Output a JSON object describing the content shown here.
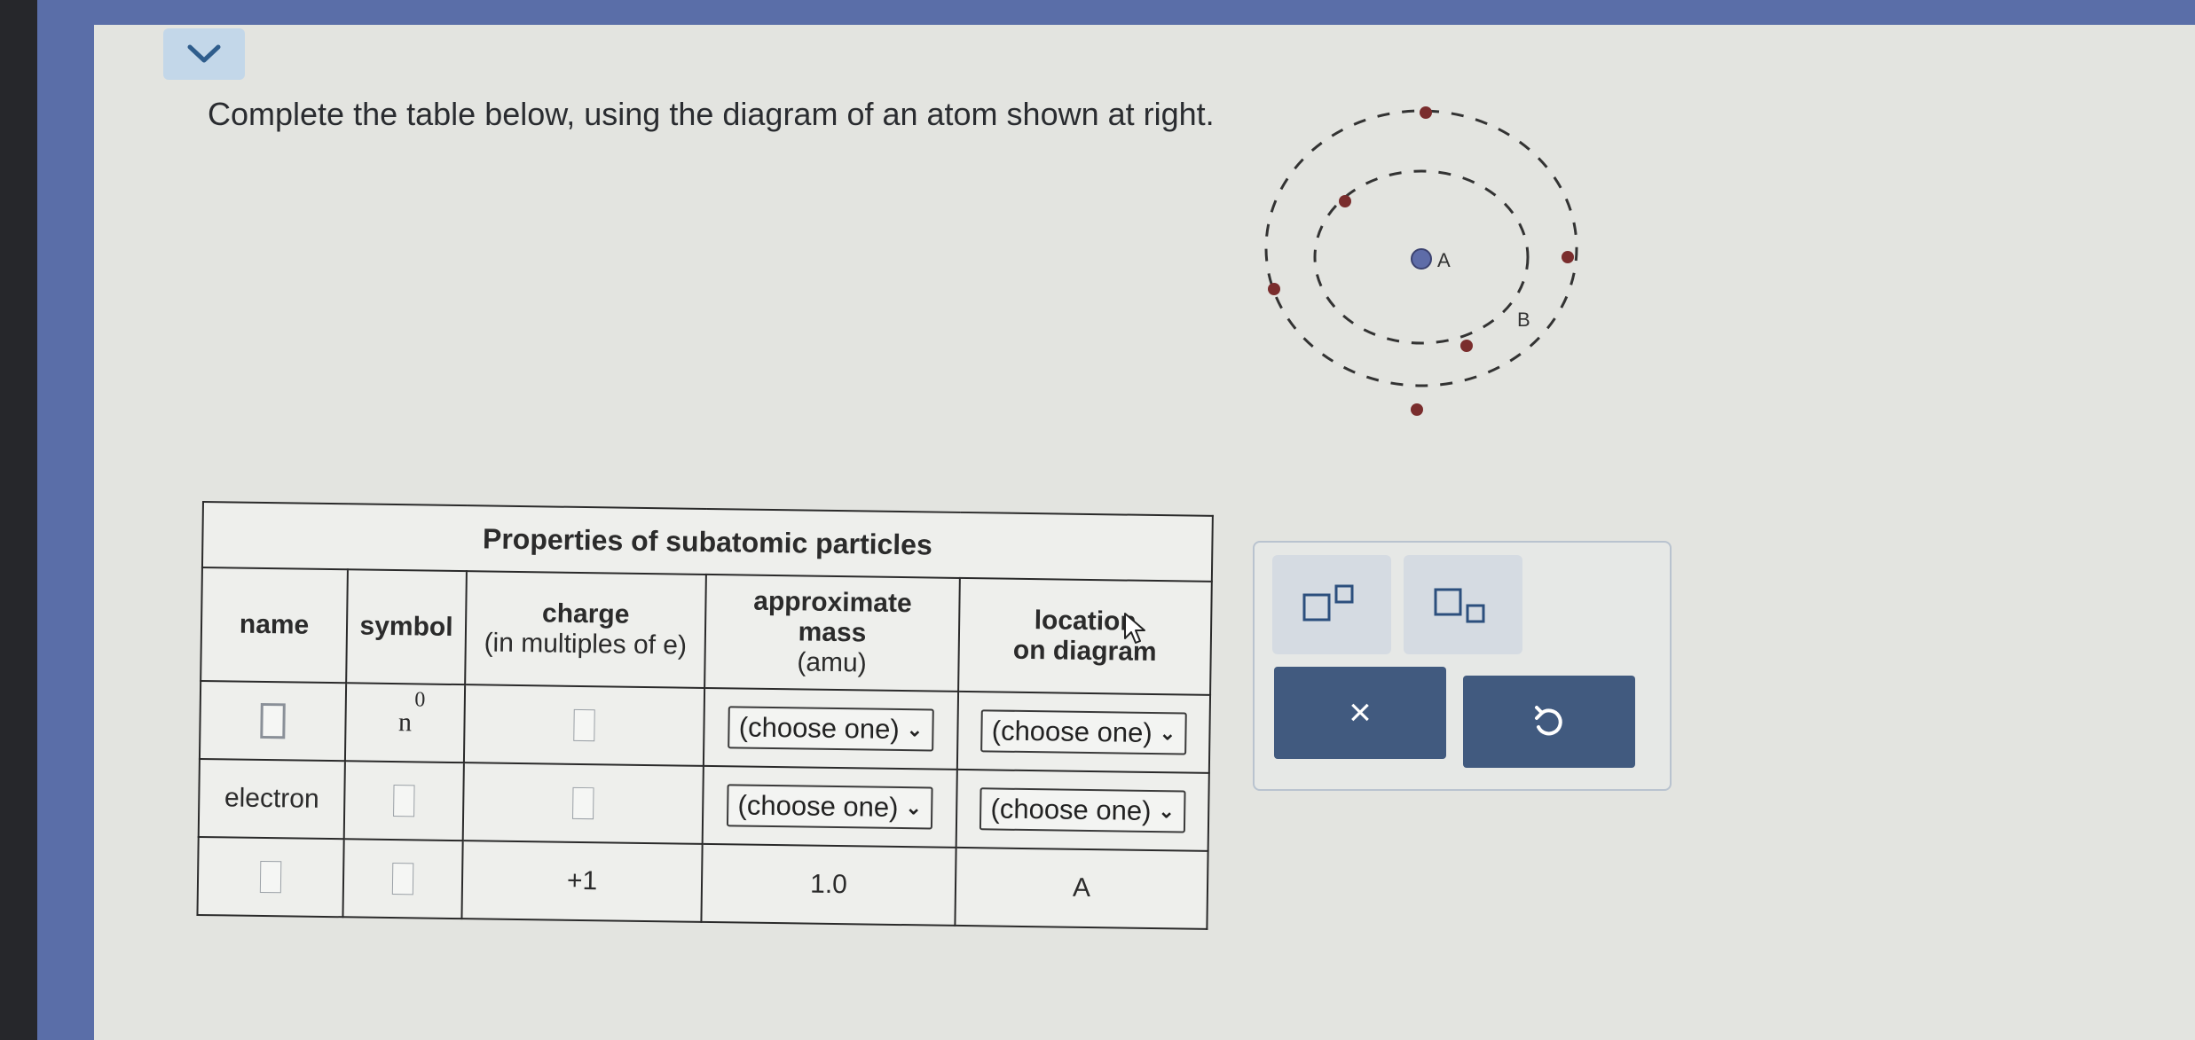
{
  "prompt": "Complete the table below, using the diagram of an atom shown at right.",
  "atom_diagram": {
    "nucleus_label": "A",
    "orbit_label": "B"
  },
  "table": {
    "caption": "Properties of subatomic particles",
    "headers": {
      "name": "name",
      "symbol": "symbol",
      "charge": "charge",
      "charge_sub": "(in multiples of e)",
      "mass_line1": "approximate",
      "mass_line2": "mass",
      "mass_sub": "(amu)",
      "location_line1": "location",
      "location_line2": "on diagram"
    },
    "rows": [
      {
        "name": "",
        "symbol_letter": "n",
        "symbol_super": "0",
        "charge": "",
        "mass_select": "(choose one)",
        "location_select": "(choose one)"
      },
      {
        "name": "electron",
        "symbol": "",
        "charge": "",
        "mass_select": "(choose one)",
        "location_select": "(choose one)"
      },
      {
        "name": "",
        "symbol": "",
        "charge": "+1",
        "mass": "1.0",
        "location": "A"
      }
    ]
  },
  "toolbar": {
    "superscript_icon": "superscript-icon",
    "subscript_icon": "subscript-icon",
    "clear_label": "×",
    "undo_icon": "undo-icon"
  },
  "colors": {
    "action_button": "#415a7f",
    "tool_button": "#d5dbe2",
    "collapse_button": "#c3d7e9"
  }
}
